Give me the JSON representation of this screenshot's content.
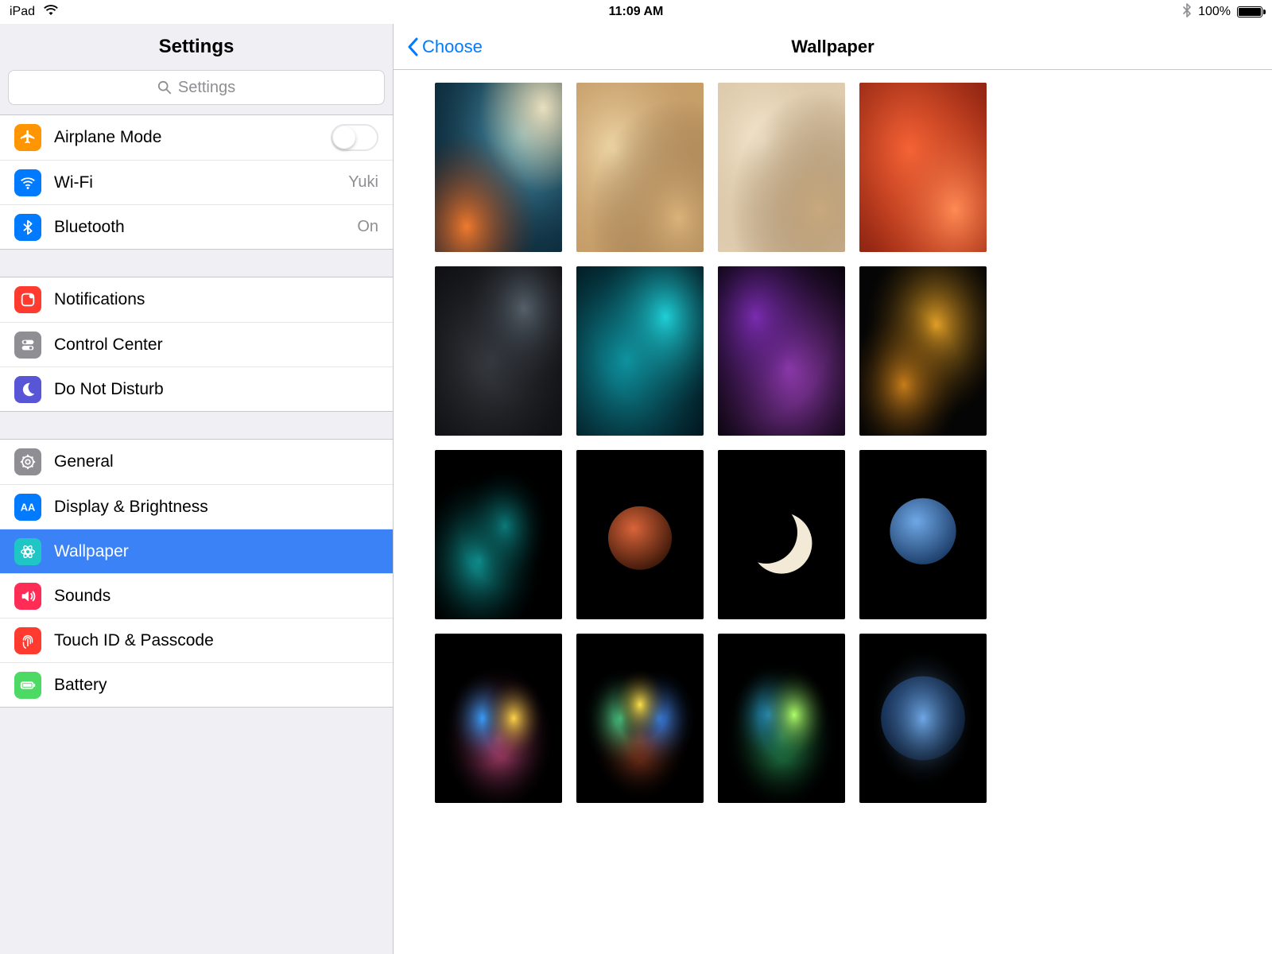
{
  "status": {
    "device": "iPad",
    "time": "11:09 AM",
    "battery_pct": "100%"
  },
  "sidebar": {
    "title": "Settings",
    "search_placeholder": "Settings",
    "groups": [
      {
        "rows": [
          {
            "id": "airplane",
            "label": "Airplane Mode",
            "icon": "airplane-icon",
            "icon_bg": "#ff9500",
            "control": "toggle",
            "toggled": false
          },
          {
            "id": "wifi",
            "label": "Wi-Fi",
            "icon": "wifi-icon",
            "icon_bg": "#007aff",
            "value": "Yuki"
          },
          {
            "id": "bluetooth",
            "label": "Bluetooth",
            "icon": "bluetooth-icon",
            "icon_bg": "#007aff",
            "value": "On"
          }
        ]
      },
      {
        "rows": [
          {
            "id": "notifications",
            "label": "Notifications",
            "icon": "notifications-icon",
            "icon_bg": "#ff3b30"
          },
          {
            "id": "controlcenter",
            "label": "Control Center",
            "icon": "control-center-icon",
            "icon_bg": "#8e8e93"
          },
          {
            "id": "dnd",
            "label": "Do Not Disturb",
            "icon": "moon-icon",
            "icon_bg": "#5856d6"
          }
        ]
      },
      {
        "rows": [
          {
            "id": "general",
            "label": "General",
            "icon": "gear-icon",
            "icon_bg": "#8e8e93"
          },
          {
            "id": "display",
            "label": "Display & Brightness",
            "icon": "brightness-icon",
            "icon_bg": "#007aff"
          },
          {
            "id": "wallpaper",
            "label": "Wallpaper",
            "icon": "wallpaper-icon",
            "icon_bg": "#20c5c5",
            "selected": true
          },
          {
            "id": "sounds",
            "label": "Sounds",
            "icon": "speaker-icon",
            "icon_bg": "#ff2d55"
          },
          {
            "id": "touchid",
            "label": "Touch ID & Passcode",
            "icon": "fingerprint-icon",
            "icon_bg": "#ff3b30"
          },
          {
            "id": "battery",
            "label": "Battery",
            "icon": "battery-icon",
            "icon_bg": "#4cd964"
          }
        ]
      }
    ]
  },
  "detail": {
    "back_label": "Choose",
    "title": "Wallpaper",
    "thumbs": [
      {
        "name": "wave-blue-orange",
        "bg": "#0b2a3a",
        "shapes": [
          [
            "rad",
            "#5fb7d6",
            "#0b2a3a",
            0.7,
            0.3,
            0.9
          ],
          [
            "rad",
            "#f07a2e",
            "#6a2210",
            0.25,
            0.85,
            0.55
          ],
          [
            "rad",
            "#e9dfbf",
            "#caa36a",
            0.85,
            0.15,
            0.5
          ]
        ]
      },
      {
        "name": "dune-sand",
        "bg": "#caa26a",
        "shapes": [
          [
            "rad",
            "#f0d9a8",
            "#a9784a",
            0.3,
            0.4,
            0.9
          ],
          [
            "rad",
            "#dab27a",
            "#6d4e2e",
            0.8,
            0.8,
            0.7
          ]
        ]
      },
      {
        "name": "dune-soft",
        "bg": "#e6d5b8",
        "shapes": [
          [
            "rad",
            "#f6e9cf",
            "#b89b78",
            0.35,
            0.35,
            0.9
          ],
          [
            "rad",
            "#c9a97e",
            "#7a5e3e",
            0.8,
            0.75,
            0.7
          ]
        ]
      },
      {
        "name": "flamingo-feathers",
        "bg": "#7a1d0e",
        "shapes": [
          [
            "rad",
            "#ff6a3a",
            "#b22a12",
            0.4,
            0.4,
            1.0
          ],
          [
            "rad",
            "#ff8b55",
            "#cc3a18",
            0.75,
            0.75,
            0.7
          ]
        ]
      },
      {
        "name": "wing-grey",
        "bg": "#0d0d10",
        "shapes": [
          [
            "rad",
            "#3a3e44",
            "#0d0d10",
            0.45,
            0.55,
            0.95
          ],
          [
            "rad",
            "#55606a",
            "#14161a",
            0.7,
            0.25,
            0.5
          ]
        ]
      },
      {
        "name": "feather-teal",
        "bg": "#021018",
        "shapes": [
          [
            "rad",
            "#0fa3b1",
            "#032a33",
            0.4,
            0.55,
            0.9
          ],
          [
            "rad",
            "#1fd0d8",
            "#06434b",
            0.7,
            0.3,
            0.55
          ]
        ]
      },
      {
        "name": "feather-purple",
        "bg": "#060308",
        "shapes": [
          [
            "rad",
            "#b44bd6",
            "#2b0d3a",
            0.55,
            0.6,
            0.8
          ],
          [
            "rad",
            "#7a2cb0",
            "#120520",
            0.3,
            0.3,
            0.6
          ]
        ]
      },
      {
        "name": "flowers-gold",
        "bg": "#050505",
        "shapes": [
          [
            "rad",
            "#e6a227",
            "#3a2706",
            0.6,
            0.35,
            0.55
          ],
          [
            "rad",
            "#c77d1a",
            "#2a1a05",
            0.35,
            0.7,
            0.45
          ]
        ]
      },
      {
        "name": "abstract-teal",
        "bg": "#000000",
        "shapes": [
          [
            "rad",
            "#12a3a3",
            "#001414",
            0.35,
            0.65,
            0.5
          ],
          [
            "rad",
            "#0c7a7a",
            "#000a0a",
            0.55,
            0.45,
            0.35
          ]
        ]
      },
      {
        "name": "mars",
        "bg": "#000000",
        "shapes": [
          [
            "circ",
            "#d9643a",
            "#3a1608",
            0.5,
            0.52,
            0.25
          ]
        ]
      },
      {
        "name": "moon-crescent",
        "bg": "#000000",
        "shapes": [
          [
            "cres",
            "#f2ead6",
            "#000000",
            0.5,
            0.55,
            0.24
          ]
        ]
      },
      {
        "name": "neptune",
        "bg": "#000000",
        "shapes": [
          [
            "circ",
            "#6fa8e6",
            "#1a3a66",
            0.5,
            0.48,
            0.26
          ]
        ]
      },
      {
        "name": "ink-burst-pink",
        "bg": "#000000",
        "shapes": [
          [
            "rad",
            "#ff5fa2",
            "#000000",
            0.5,
            0.62,
            0.45
          ],
          [
            "rad",
            "#3aa0ff",
            "#000000",
            0.38,
            0.5,
            0.28
          ],
          [
            "rad",
            "#ffd44a",
            "#000000",
            0.62,
            0.5,
            0.25
          ]
        ]
      },
      {
        "name": "ink-burst-rainbow",
        "bg": "#000000",
        "shapes": [
          [
            "rad",
            "#ff6a3a",
            "#000000",
            0.5,
            0.6,
            0.4
          ],
          [
            "rad",
            "#4ad991",
            "#000000",
            0.35,
            0.5,
            0.3
          ],
          [
            "rad",
            "#3a8cff",
            "#000000",
            0.65,
            0.5,
            0.3
          ],
          [
            "rad",
            "#ffe14a",
            "#000000",
            0.5,
            0.42,
            0.22
          ]
        ]
      },
      {
        "name": "ink-burst-green",
        "bg": "#000000",
        "shapes": [
          [
            "rad",
            "#3ad97a",
            "#000000",
            0.5,
            0.6,
            0.45
          ],
          [
            "rad",
            "#2aa0d9",
            "#000000",
            0.4,
            0.48,
            0.3
          ],
          [
            "rad",
            "#b0ff6a",
            "#000000",
            0.6,
            0.48,
            0.28
          ]
        ]
      },
      {
        "name": "dandelion-blue",
        "bg": "#000000",
        "shapes": [
          [
            "circ",
            "#2a5aa0",
            "#0a1a33",
            0.5,
            0.5,
            0.33
          ],
          [
            "rad",
            "#6fa8e6",
            "#000000",
            0.5,
            0.5,
            0.42
          ]
        ]
      }
    ]
  }
}
